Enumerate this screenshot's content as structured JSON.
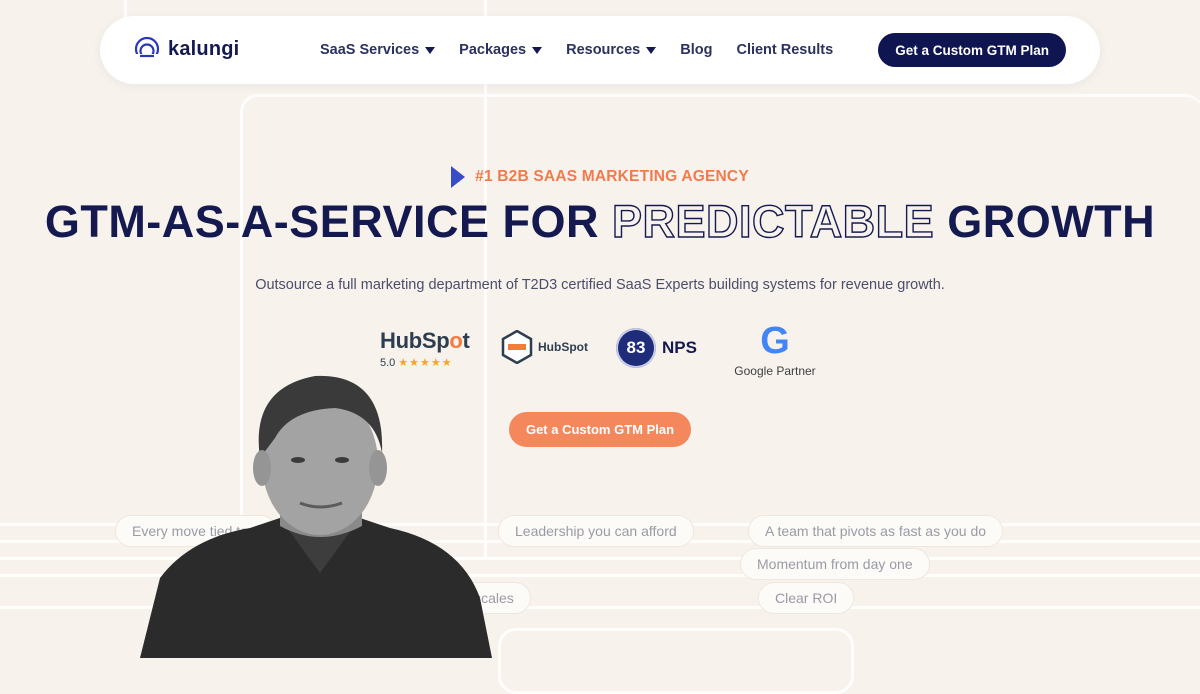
{
  "brand": {
    "name": "kalungi",
    "accent": "#f27a4d",
    "navy": "#141a4f"
  },
  "nav": {
    "items": [
      {
        "label": "SaaS Services",
        "dropdown": true
      },
      {
        "label": "Packages",
        "dropdown": true
      },
      {
        "label": "Resources",
        "dropdown": true
      },
      {
        "label": "Blog",
        "dropdown": false
      },
      {
        "label": "Client Results",
        "dropdown": false
      }
    ],
    "cta": "Get a Custom GTM Plan"
  },
  "hero": {
    "eyebrow": "#1 B2B SAAS MARKETING AGENCY",
    "headline_part1": "GTM-AS-A-SERVICE FOR ",
    "headline_outline": "PREDICTABLE",
    "headline_part2": " GROWTH",
    "subtitle": "Outsource a full marketing department of T2D3 certified SaaS Experts building systems for revenue growth.",
    "cta": "Get a Custom GTM Plan"
  },
  "badges": {
    "hubspot_word_a": "HubSp",
    "hubspot_word_o": "o",
    "hubspot_word_b": "t",
    "hubspot_rating": "5.0",
    "hubspot_stars": "★★★★★",
    "partner_label": "HubSpot",
    "nps_score": "83",
    "nps_label": "NPS",
    "google_letter": "G",
    "google_label": "Google Partner"
  },
  "pills": [
    "Every move tied to a",
    "Leadership you can afford",
    "A team that pivots as fast as you do",
    "Momentum from day one",
    "lly scales",
    "Clear ROI"
  ]
}
